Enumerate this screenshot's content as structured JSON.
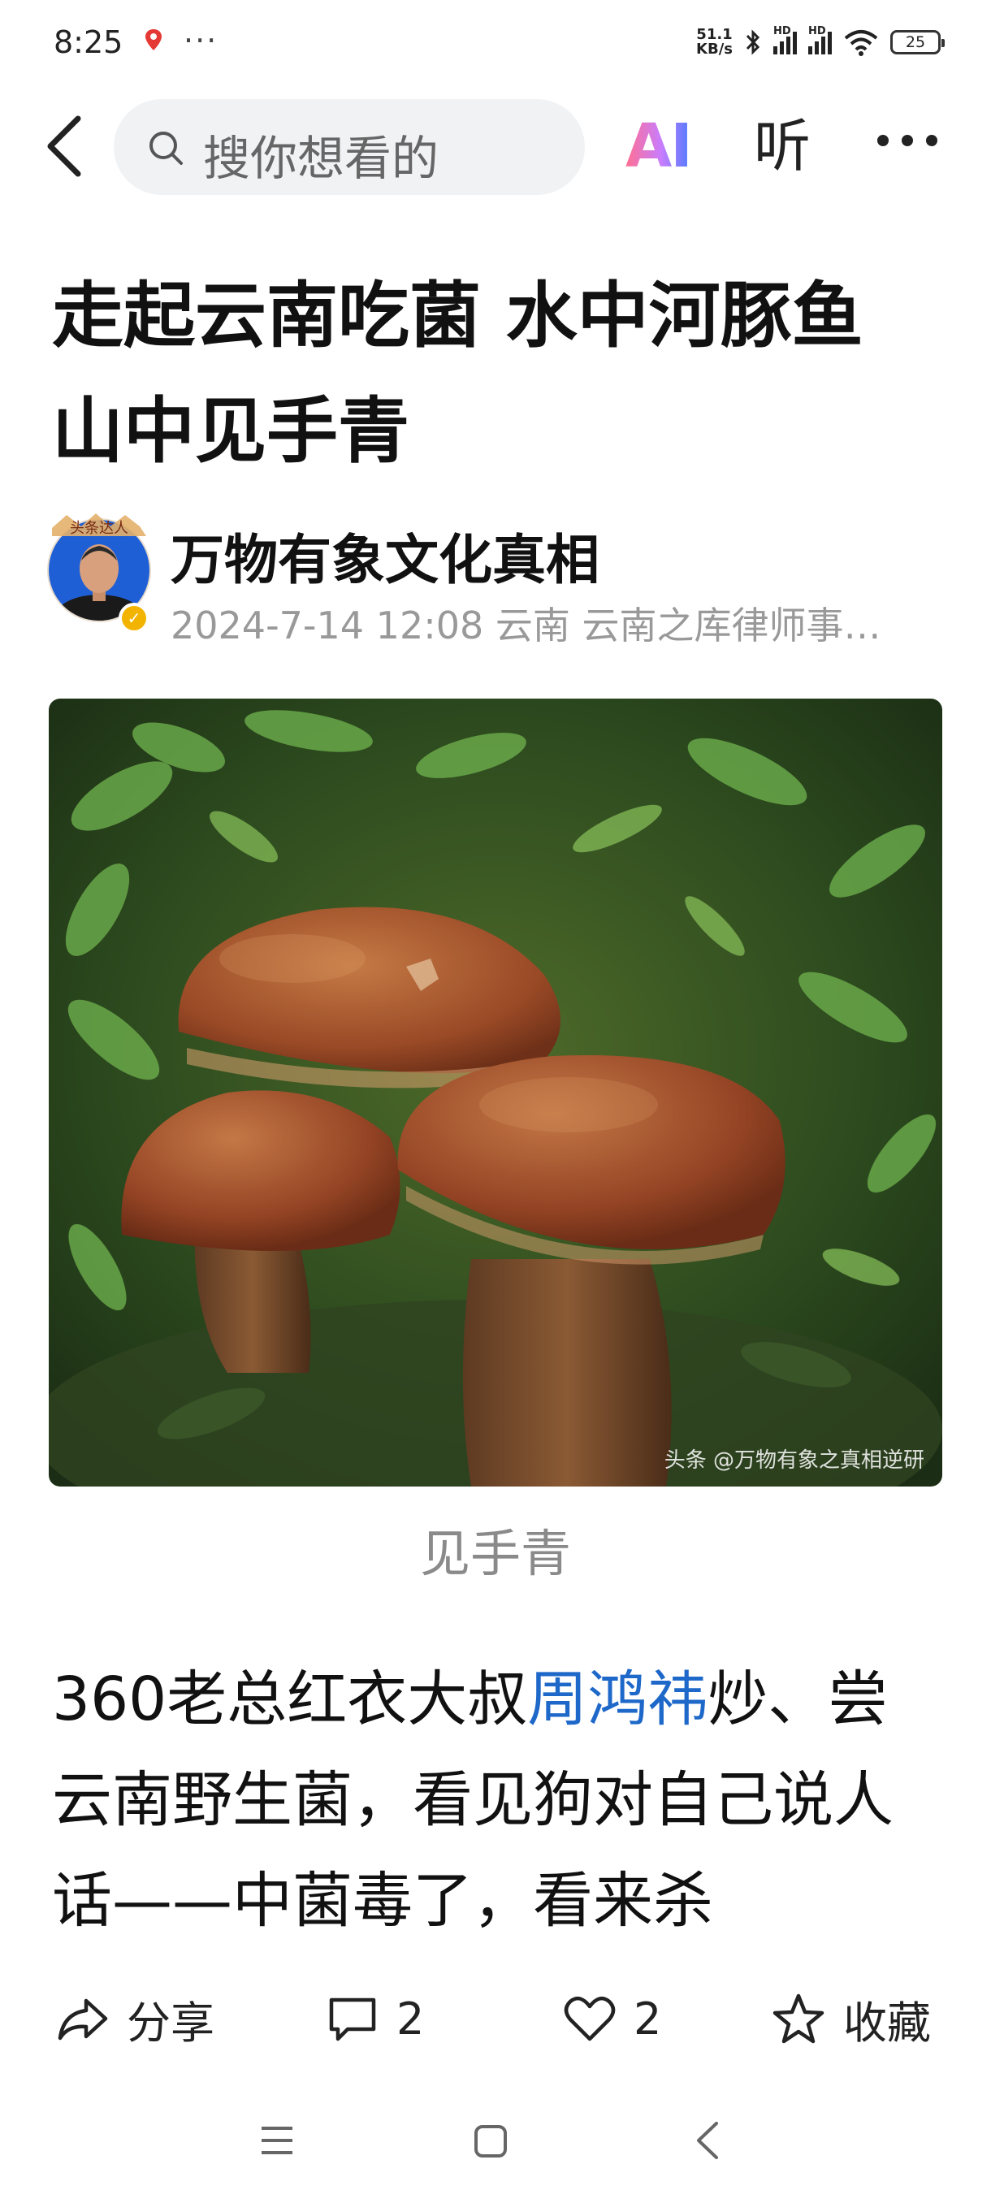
{
  "status_bar": {
    "time": "8:25",
    "more": "···",
    "speed_value": "51.1",
    "speed_unit": "KB/s",
    "hd_label": "HD",
    "battery": "25"
  },
  "nav": {
    "search_placeholder": "搜你想看的",
    "ai_label": "AI",
    "listen_label": "听"
  },
  "article": {
    "title_line1": "走起云南吃菌 水中河豚鱼",
    "title_line2": "山中见手青",
    "author": "万物有象文化真相",
    "avatar_badge_text": "头条达人",
    "meta": "2024-7-14 12:08  云南  云南之库律师事…",
    "image_watermark": "头条 @万物有象之真相逆研",
    "image_caption": "见手青",
    "body_before_link": "360老总红衣大叔",
    "body_link": "周鸿祎",
    "body_after_link": "炒、尝云南野生菌，看见狗对自己说人话——中菌毒了，看来杀"
  },
  "actions": {
    "share_label": "分享",
    "comment_count": "2",
    "like_count": "2",
    "favorite_label": "收藏"
  },
  "colors": {
    "link": "#1e68c9",
    "meta_gray": "#999999",
    "verified": "#f2b400"
  }
}
